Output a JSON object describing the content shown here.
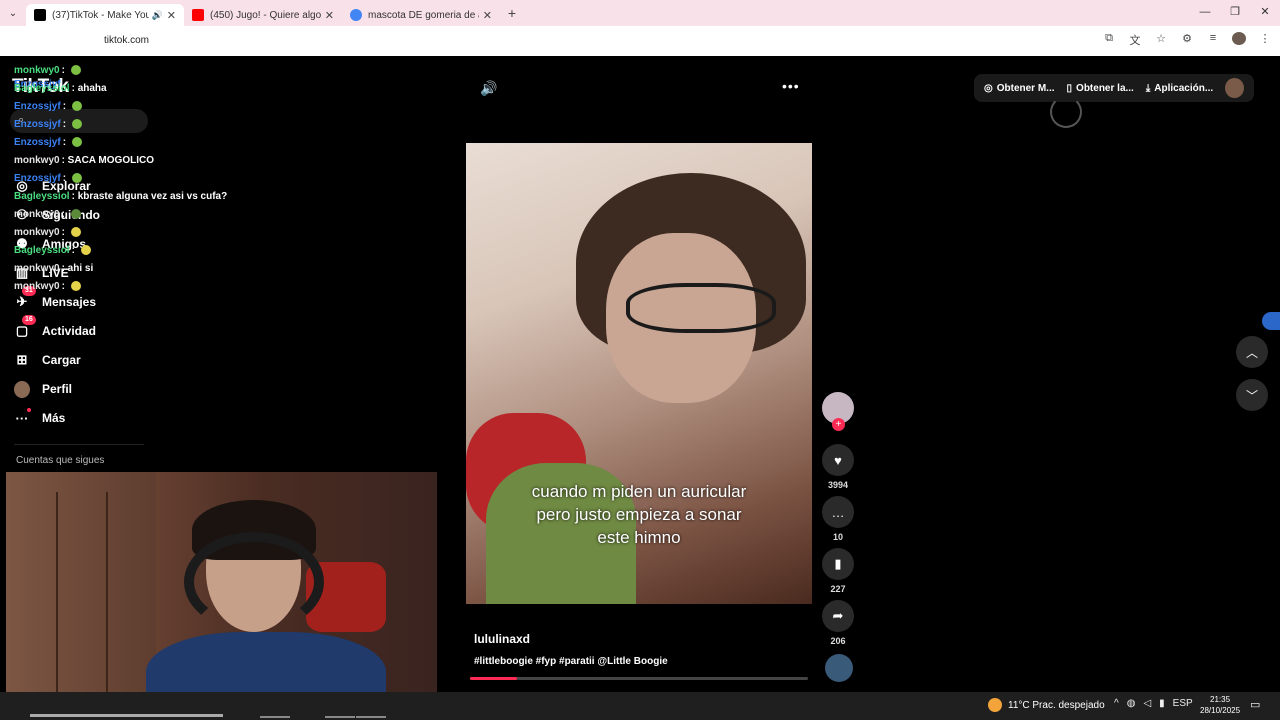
{
  "browser": {
    "tabs": [
      {
        "title": "(37)TikTok - Make Your Day",
        "favicon_color": "#000000",
        "active": true
      },
      {
        "title": "(450) Jugo! - Quiere algo de mi",
        "favicon_color": "#ff0000",
        "active": false
      },
      {
        "title": "mascota DE gomeria de autos -",
        "favicon_color": "#4285f4",
        "active": false
      }
    ],
    "new_tab": "+",
    "url": "tiktok.com",
    "window_controls": [
      "—",
      "❐",
      "✕"
    ]
  },
  "tiktok": {
    "logo": "TikTok",
    "nav": [
      {
        "label": "Explorar",
        "icon": "compass-icon"
      },
      {
        "label": "Siguiendo",
        "icon": "following-icon"
      },
      {
        "label": "Amigos",
        "icon": "friends-icon"
      },
      {
        "label": "LIVE",
        "icon": "live-icon"
      },
      {
        "label": "Mensajes",
        "icon": "message-icon",
        "badge": "31"
      },
      {
        "label": "Actividad",
        "icon": "activity-icon",
        "badge": "16"
      },
      {
        "label": "Cargar",
        "icon": "upload-icon"
      },
      {
        "label": "Perfil",
        "icon": "avatar"
      },
      {
        "label": "Más",
        "icon": "more-icon"
      }
    ],
    "following_heading": "Cuentas que sigues",
    "top_buttons": [
      "Obtener M...",
      "Obtener la...",
      "Aplicación..."
    ],
    "video": {
      "caption": "cuando m piden un auricular\npero justo empieza a sonar\neste himno",
      "author": "lululinaxd",
      "tags": "#littleboogie #fyp #paratii @Little Boogie",
      "progress": 0.14
    },
    "actions": {
      "likes": "3994",
      "comments": "10",
      "saves": "227",
      "shares": "206"
    }
  },
  "chat": [
    {
      "user": "monkwy0",
      "user_color": "#4ade80",
      "text": ": ",
      "emote": "#7bc043"
    },
    {
      "user": "Enzossjyf",
      "user_color": "#3b82f6",
      "text": "",
      "emote": ""
    },
    {
      "user": "Bagleyssiol",
      "user_color": "#4ade80",
      "text": ": ahaha",
      "emote": ""
    },
    {
      "user": "Enzossjyf",
      "user_color": "#3b82f6",
      "text": ": ",
      "emote": "#7bc043"
    },
    {
      "user": "Enzossjyf",
      "user_color": "#3b82f6",
      "text": ": ",
      "emote": "#7bc043"
    },
    {
      "user": "Enzossjyf",
      "user_color": "#3b82f6",
      "text": ": ",
      "emote": "#7bc043"
    },
    {
      "user": "monkwy0",
      "user_color": "#e5e5e5",
      "text": ": SACA MOGOLICO",
      "emote": ""
    },
    {
      "user": "Enzossjyf",
      "user_color": "#3b82f6",
      "text": ": ",
      "emote": "#7bc043"
    },
    {
      "user": "Bagleyssiol",
      "user_color": "#4ade80",
      "text": ": kbraste alguna vez asi vs cufa?",
      "emote": ""
    },
    {
      "user": "monkwy0",
      "user_color": "#e5e5e5",
      "text": ": ",
      "emote": "#5a8a3a"
    },
    {
      "user": "monkwy0",
      "user_color": "#e5e5e5",
      "text": ": ",
      "emote": "#e3d24a"
    },
    {
      "user": "Bagleyssiol",
      "user_color": "#4ade80",
      "text": ": ",
      "emote": "#e3d24a"
    },
    {
      "user": "monkwy0",
      "user_color": "#e5e5e5",
      "text": ": ahi si",
      "emote": ""
    },
    {
      "user": "monkwy0",
      "user_color": "#e5e5e5",
      "text": ": ",
      "emote": "#e3d24a"
    }
  ],
  "taskbar": {
    "weather": "11°C  Prac. despejado",
    "lang": "ESP",
    "time": "21:35",
    "date": "28/10/2025"
  }
}
